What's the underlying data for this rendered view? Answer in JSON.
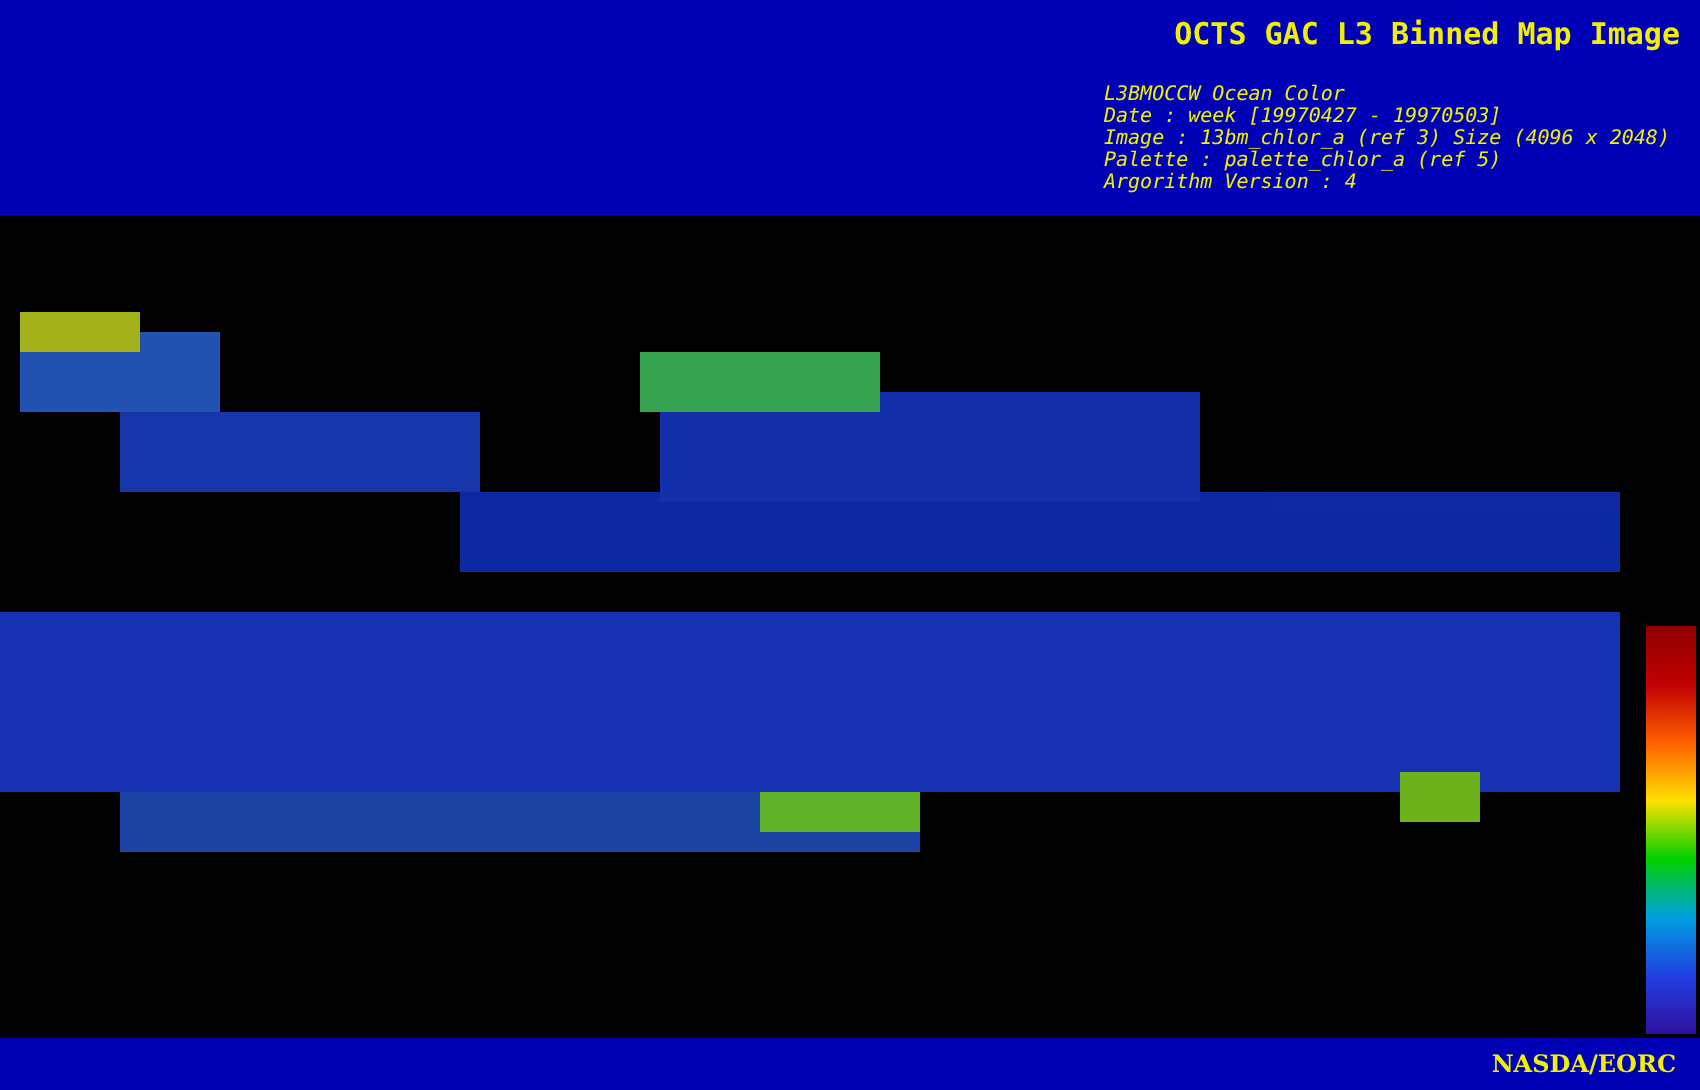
{
  "header": {
    "title": "OCTS GAC L3 Binned Map Image",
    "info_lines": [
      "L3BMOCCW Ocean Color",
      "Date : week [19970427 - 19970503]",
      "Image : 13bm_chlor_a (ref 3) Size (4096 x 2048)",
      "Palette : palette_chlor_a (ref 5)",
      "Argorithm Version : 4"
    ]
  },
  "footer": {
    "credit": "NASDA/EORC"
  }
}
